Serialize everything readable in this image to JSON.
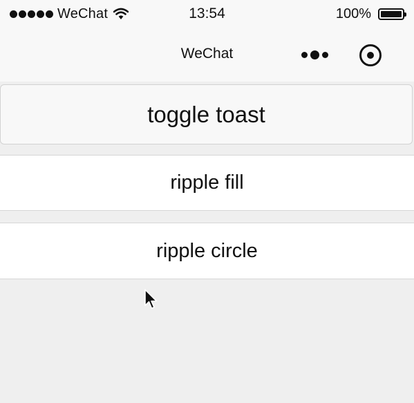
{
  "status_bar": {
    "carrier": "WeChat",
    "time": "13:54",
    "battery_percent": "100%"
  },
  "nav_bar": {
    "title": "WeChat"
  },
  "buttons": {
    "toggle_toast": "toggle toast",
    "ripple_fill": "ripple fill",
    "ripple_circle": "ripple circle"
  }
}
